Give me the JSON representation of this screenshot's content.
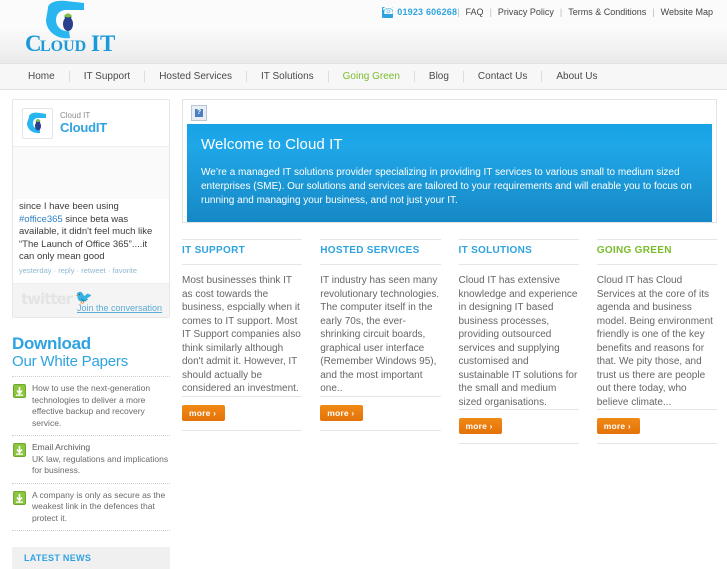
{
  "topbar": {
    "phone_icon": "phone-icon",
    "phone": "01923 606268",
    "links": [
      {
        "label": "FAQ"
      },
      {
        "label": "Privacy Policy"
      },
      {
        "label": "Terms & Conditions"
      },
      {
        "label": "Website Map"
      }
    ],
    "separator": "|"
  },
  "brand": {
    "word1": "C",
    "word1_rest": "LOUD",
    "word2": "IT",
    "full": "Cloud IT"
  },
  "mainnav": {
    "items": [
      {
        "label": "Home",
        "accent": false
      },
      {
        "label": "IT Support",
        "accent": false
      },
      {
        "label": "Hosted Services",
        "accent": false
      },
      {
        "label": "IT Solutions",
        "accent": false
      },
      {
        "label": "Going Green",
        "accent": true
      },
      {
        "label": "Blog",
        "accent": false
      },
      {
        "label": "Contact Us",
        "accent": false
      },
      {
        "label": "About Us",
        "accent": false
      }
    ]
  },
  "sidebar": {
    "twitter": {
      "handle_small": "Cloud IT",
      "handle_big": "CloudIT",
      "tweet_pre": "since I have been using ",
      "tweet_hash": "#office365",
      "tweet_post": " since beta was available, it didn't feel much like “The Launch of Office 365”....it can only mean good",
      "meta_yesterday": "yesterday",
      "meta_reply": "reply",
      "meta_retweet": "retweet",
      "meta_favorite": "favorite",
      "meta_dot": "·",
      "brand_text": "twitter",
      "bird_icon": "twitter-bird-icon",
      "join": "Join the conversation"
    },
    "download": {
      "line1": "Download",
      "line2": "Our White Papers",
      "papers": [
        {
          "icon": "download-arrow-icon",
          "text": "How to use the next-generation technologies to deliver a more effective backup and recovery service."
        },
        {
          "icon": "download-arrow-icon",
          "title": "Email Archiving",
          "text": "UK law, regulations and implications for business."
        },
        {
          "icon": "download-arrow-icon",
          "text": "A company is only as secure as the weakest link in the defences that protect it."
        }
      ]
    },
    "latest_news": "LATEST NEWS"
  },
  "banner": {
    "broken_image_icon": "broken-image-icon",
    "title": "Welcome to Cloud IT",
    "body": "We’re a managed IT solutions provider specializing in providing IT services to various small to medium sized enterprises (SME). Our solutions and services are tailored to your requirements and will enable you to focus on running and managing your business, and not just your IT."
  },
  "columns": [
    {
      "heading": "IT SUPPORT",
      "accent": false,
      "body": "Most businesses think IT as cost towards the business, espcially when it comes to IT support. Most IT Support companies also think similarly although don't admit it. However, IT should actually be considered an investment.",
      "more": "more ›"
    },
    {
      "heading": "HOSTED SERVICES",
      "accent": false,
      "body": "IT industry has seen many revolutionary technologies. The computer itself in the early 70s, the ever-shrinking circuit boards, graphical user interface (Remember Windows 95), and the most important one..",
      "more": "more ›"
    },
    {
      "heading": "IT SOLUTIONS",
      "accent": false,
      "body": "Cloud IT has extensive knowledge and experience in designing IT based business processes, providing outsourced services and supplying customised and sustainable IT solutions for the small and medium sized organisations.",
      "more": "more ›"
    },
    {
      "heading": "GOING GREEN",
      "accent": true,
      "body": "Cloud IT has Cloud Services at the core of its agenda and business model. Being environment friendly is one of the key benefits and reasons for that. We pity those, and trust us there are people out there today, who believe climate...",
      "more": "more ›"
    }
  ],
  "colors": {
    "brand_blue": "#2ea3e0",
    "accent_green": "#79bd2b",
    "orange": "#e3720a",
    "banner_blue_top": "#16a3e6",
    "banner_blue_bottom": "#1688c6"
  }
}
